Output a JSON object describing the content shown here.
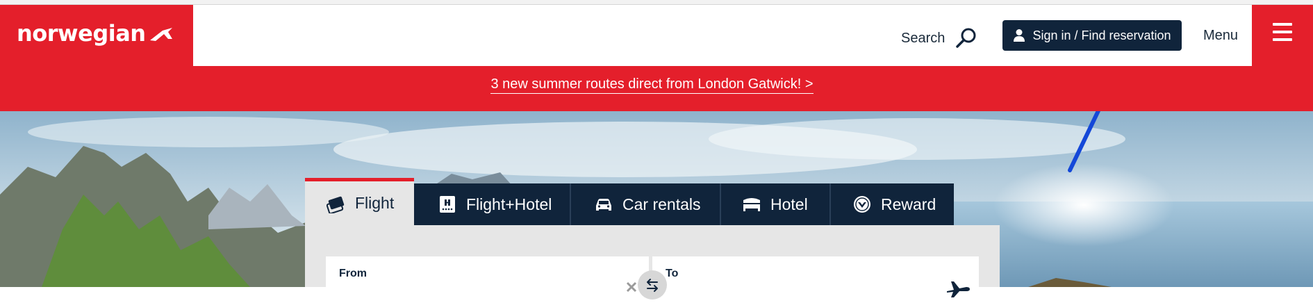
{
  "header": {
    "brand": "norwegian",
    "search_label": "Search",
    "signin_label": "Sign in / Find reservation",
    "menu_label": "Menu",
    "icons": {
      "logo": "plane-tail-icon",
      "search": "search-icon",
      "user": "user-icon",
      "menu": "hamburger-icon"
    }
  },
  "promo": {
    "text": "3 new summer routes direct from London Gatwick! >"
  },
  "tabs": [
    {
      "label": "Flight",
      "icon": "flight-ticket-icon",
      "active": true
    },
    {
      "label": "Flight+Hotel",
      "icon": "hotel-building-icon",
      "active": false
    },
    {
      "label": "Car rentals",
      "icon": "car-icon",
      "active": false
    },
    {
      "label": "Hotel",
      "icon": "bed-icon",
      "active": false
    },
    {
      "label": "Reward",
      "icon": "reward-badge-icon",
      "active": false
    }
  ],
  "search_form": {
    "from_label": "From",
    "to_label": "To"
  },
  "colors": {
    "brand_red": "#e41f2b",
    "navy": "#10243b",
    "annotation_arrow": "#1448d8"
  }
}
